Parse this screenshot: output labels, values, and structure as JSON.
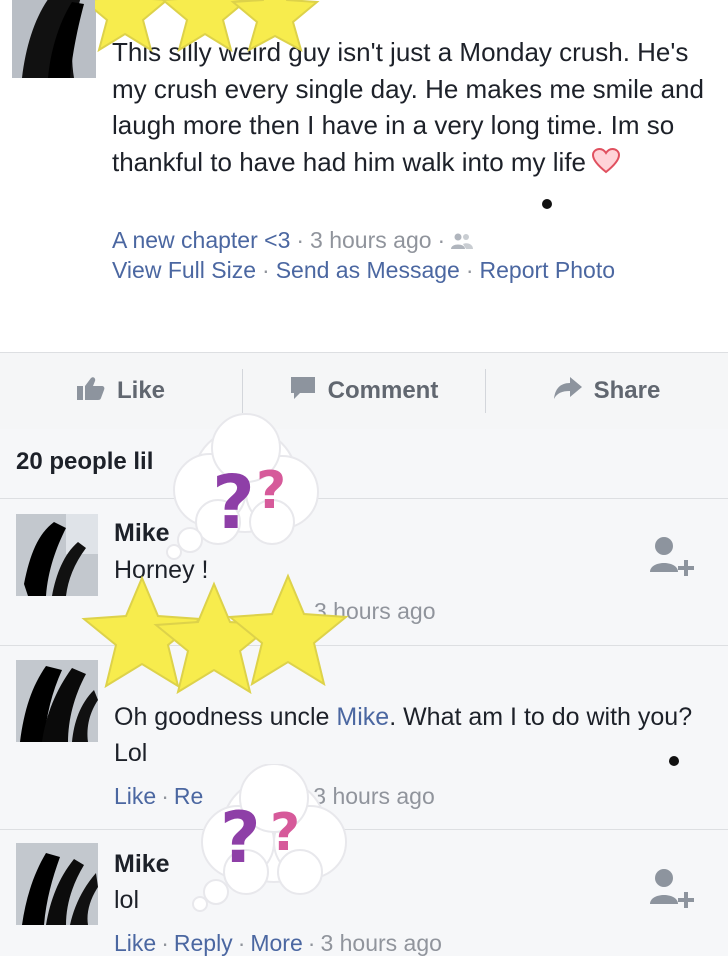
{
  "post": {
    "caption": "This silly weird guy isn't just a Monday crush. He's my crush every single day. He makes me smile and laugh more then I have in a very long time. Im so thankful to have had him walk into my life",
    "album": "A new chapter <3",
    "time": "3 hours ago",
    "links": {
      "view_full_size": "View Full Size",
      "send_as_message": "Send as Message",
      "report_photo": "Report Photo"
    }
  },
  "actions": {
    "like": "Like",
    "comment": "Comment",
    "share": "Share"
  },
  "likes_summary": "20 people lil",
  "comments": [
    {
      "name": "Mike",
      "text": "Horney !",
      "time": "3 hours ago"
    },
    {
      "text_before": "Oh goodness uncle ",
      "mention": "Mike",
      "text_after": ". What am I to do with you? Lol",
      "like": "Like",
      "reply_partial": "Re",
      "time": "3 hours ago"
    },
    {
      "name": "Mike",
      "text": "lol",
      "like": "Like",
      "reply": "Reply",
      "more": "More",
      "time": "3 hours ago"
    }
  ],
  "colors": {
    "link": "#4b67a1",
    "muted": "#90949c",
    "star": "#f7ec4d",
    "question_purple": "#8e3fa7",
    "question_pink": "#d65a9a"
  }
}
